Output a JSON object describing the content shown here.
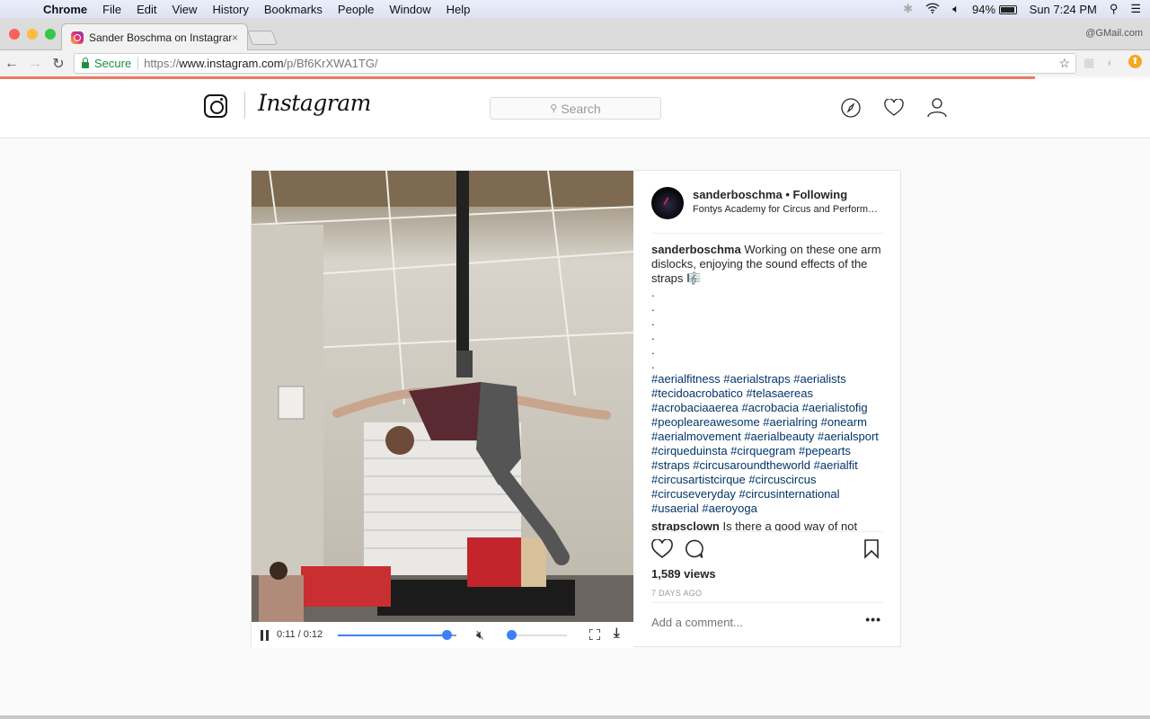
{
  "menubar": {
    "app": "Chrome",
    "items": [
      "File",
      "Edit",
      "View",
      "History",
      "Bookmarks",
      "People",
      "Window",
      "Help"
    ],
    "battery": "94%",
    "clock": "Sun 7:24 PM"
  },
  "browser": {
    "tab_title": "Sander Boschma on Instagram",
    "tab_close": "×",
    "profile": "@GMail.com",
    "secure_label": "Secure",
    "url_scheme": "https://",
    "url_host": "www.instagram.com",
    "url_path": "/p/Bf6KrXWA1TG/",
    "page_load_progress": 0.9
  },
  "instagram": {
    "wordmark": "Instagram",
    "search_placeholder": "Search"
  },
  "post": {
    "username": "sanderboschma",
    "follow_state": "Following",
    "location": "Fontys Academy for Circus and Performance Art",
    "caption_user": "sanderboschma",
    "caption": "Working on these one arm dislocks, enjoying the sound effects of the straps 🎼",
    "caption_dots": [
      ".",
      ".",
      ".",
      ".",
      ".",
      "."
    ],
    "hashtags": "#aerialfitness #aerialstraps #aerialists #tecidoacrobatico #telasaereas #acrobaciaaerea #acrobacia #aerialistofig #peopleareawesome #aerialring #onearm #aerialmovement #aerialbeauty #aerialsport #cirqueduinsta #cirquegram #pepearts #straps #circusaroundtheworld #aerialfit #circusartistcirque #circuscircus #circuseveryday #circusinternational #usaerial #aeroyoga",
    "comment_user": "strapsclown",
    "comment_text": "Is there a good way of not",
    "views": "1,589 views",
    "time_ago": "7 DAYS AGO",
    "add_comment_placeholder": "Add a comment...",
    "more": "•••"
  },
  "video": {
    "time": "0:11 / 0:12",
    "progress": 0.917,
    "volume": 0.0,
    "muted": true
  }
}
